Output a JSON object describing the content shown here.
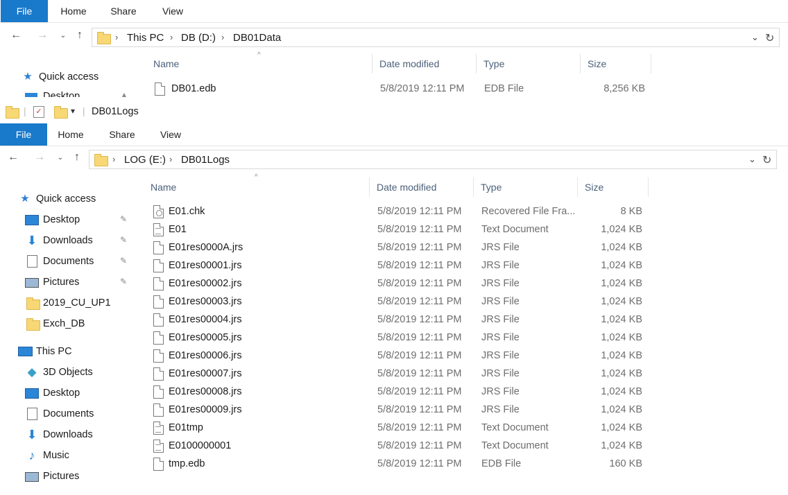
{
  "ribbon_tabs": [
    "File",
    "Home",
    "Share",
    "View"
  ],
  "window1": {
    "breadcrumb": [
      "This PC",
      "DB (D:)",
      "DB01Data"
    ],
    "columns": {
      "name": "Name",
      "date": "Date modified",
      "type": "Type",
      "size": "Size"
    },
    "nav": {
      "quick_access": "Quick access",
      "desktop_partial": "Desktop"
    },
    "files": [
      {
        "name": "DB01.edb",
        "date": "5/8/2019 12:11 PM",
        "type": "EDB File",
        "size": "8,256 KB"
      }
    ]
  },
  "window2": {
    "qat_title": "DB01Logs",
    "breadcrumb": [
      "LOG (E:)",
      "DB01Logs"
    ],
    "columns": {
      "name": "Name",
      "date": "Date modified",
      "type": "Type",
      "size": "Size"
    },
    "nav": {
      "quick_access": "Quick access",
      "desktop": "Desktop",
      "downloads": "Downloads",
      "documents": "Documents",
      "pictures": "Pictures",
      "folder1": "2019_CU_UP1",
      "folder2": "Exch_DB",
      "this_pc": "This PC",
      "objects3d": "3D Objects",
      "desktop2": "Desktop",
      "documents2": "Documents",
      "downloads2": "Downloads",
      "music": "Music",
      "pictures2": "Pictures"
    },
    "files": [
      {
        "name": "E01.chk",
        "date": "5/8/2019 12:11 PM",
        "type": "Recovered File Fra...",
        "size": "8 KB"
      },
      {
        "name": "E01",
        "date": "5/8/2019 12:11 PM",
        "type": "Text Document",
        "size": "1,024 KB"
      },
      {
        "name": "E01res0000A.jrs",
        "date": "5/8/2019 12:11 PM",
        "type": "JRS File",
        "size": "1,024 KB"
      },
      {
        "name": "E01res00001.jrs",
        "date": "5/8/2019 12:11 PM",
        "type": "JRS File",
        "size": "1,024 KB"
      },
      {
        "name": "E01res00002.jrs",
        "date": "5/8/2019 12:11 PM",
        "type": "JRS File",
        "size": "1,024 KB"
      },
      {
        "name": "E01res00003.jrs",
        "date": "5/8/2019 12:11 PM",
        "type": "JRS File",
        "size": "1,024 KB"
      },
      {
        "name": "E01res00004.jrs",
        "date": "5/8/2019 12:11 PM",
        "type": "JRS File",
        "size": "1,024 KB"
      },
      {
        "name": "E01res00005.jrs",
        "date": "5/8/2019 12:11 PM",
        "type": "JRS File",
        "size": "1,024 KB"
      },
      {
        "name": "E01res00006.jrs",
        "date": "5/8/2019 12:11 PM",
        "type": "JRS File",
        "size": "1,024 KB"
      },
      {
        "name": "E01res00007.jrs",
        "date": "5/8/2019 12:11 PM",
        "type": "JRS File",
        "size": "1,024 KB"
      },
      {
        "name": "E01res00008.jrs",
        "date": "5/8/2019 12:11 PM",
        "type": "JRS File",
        "size": "1,024 KB"
      },
      {
        "name": "E01res00009.jrs",
        "date": "5/8/2019 12:11 PM",
        "type": "JRS File",
        "size": "1,024 KB"
      },
      {
        "name": "E01tmp",
        "date": "5/8/2019 12:11 PM",
        "type": "Text Document",
        "size": "1,024 KB"
      },
      {
        "name": "E0100000001",
        "date": "5/8/2019 12:11 PM",
        "type": "Text Document",
        "size": "1,024 KB"
      },
      {
        "name": "tmp.edb",
        "date": "5/8/2019 12:11 PM",
        "type": "EDB File",
        "size": "160 KB"
      }
    ]
  },
  "colors": {
    "file_tab": "#1979ca",
    "header_text": "#4c607a",
    "folder": "#f8d775"
  }
}
